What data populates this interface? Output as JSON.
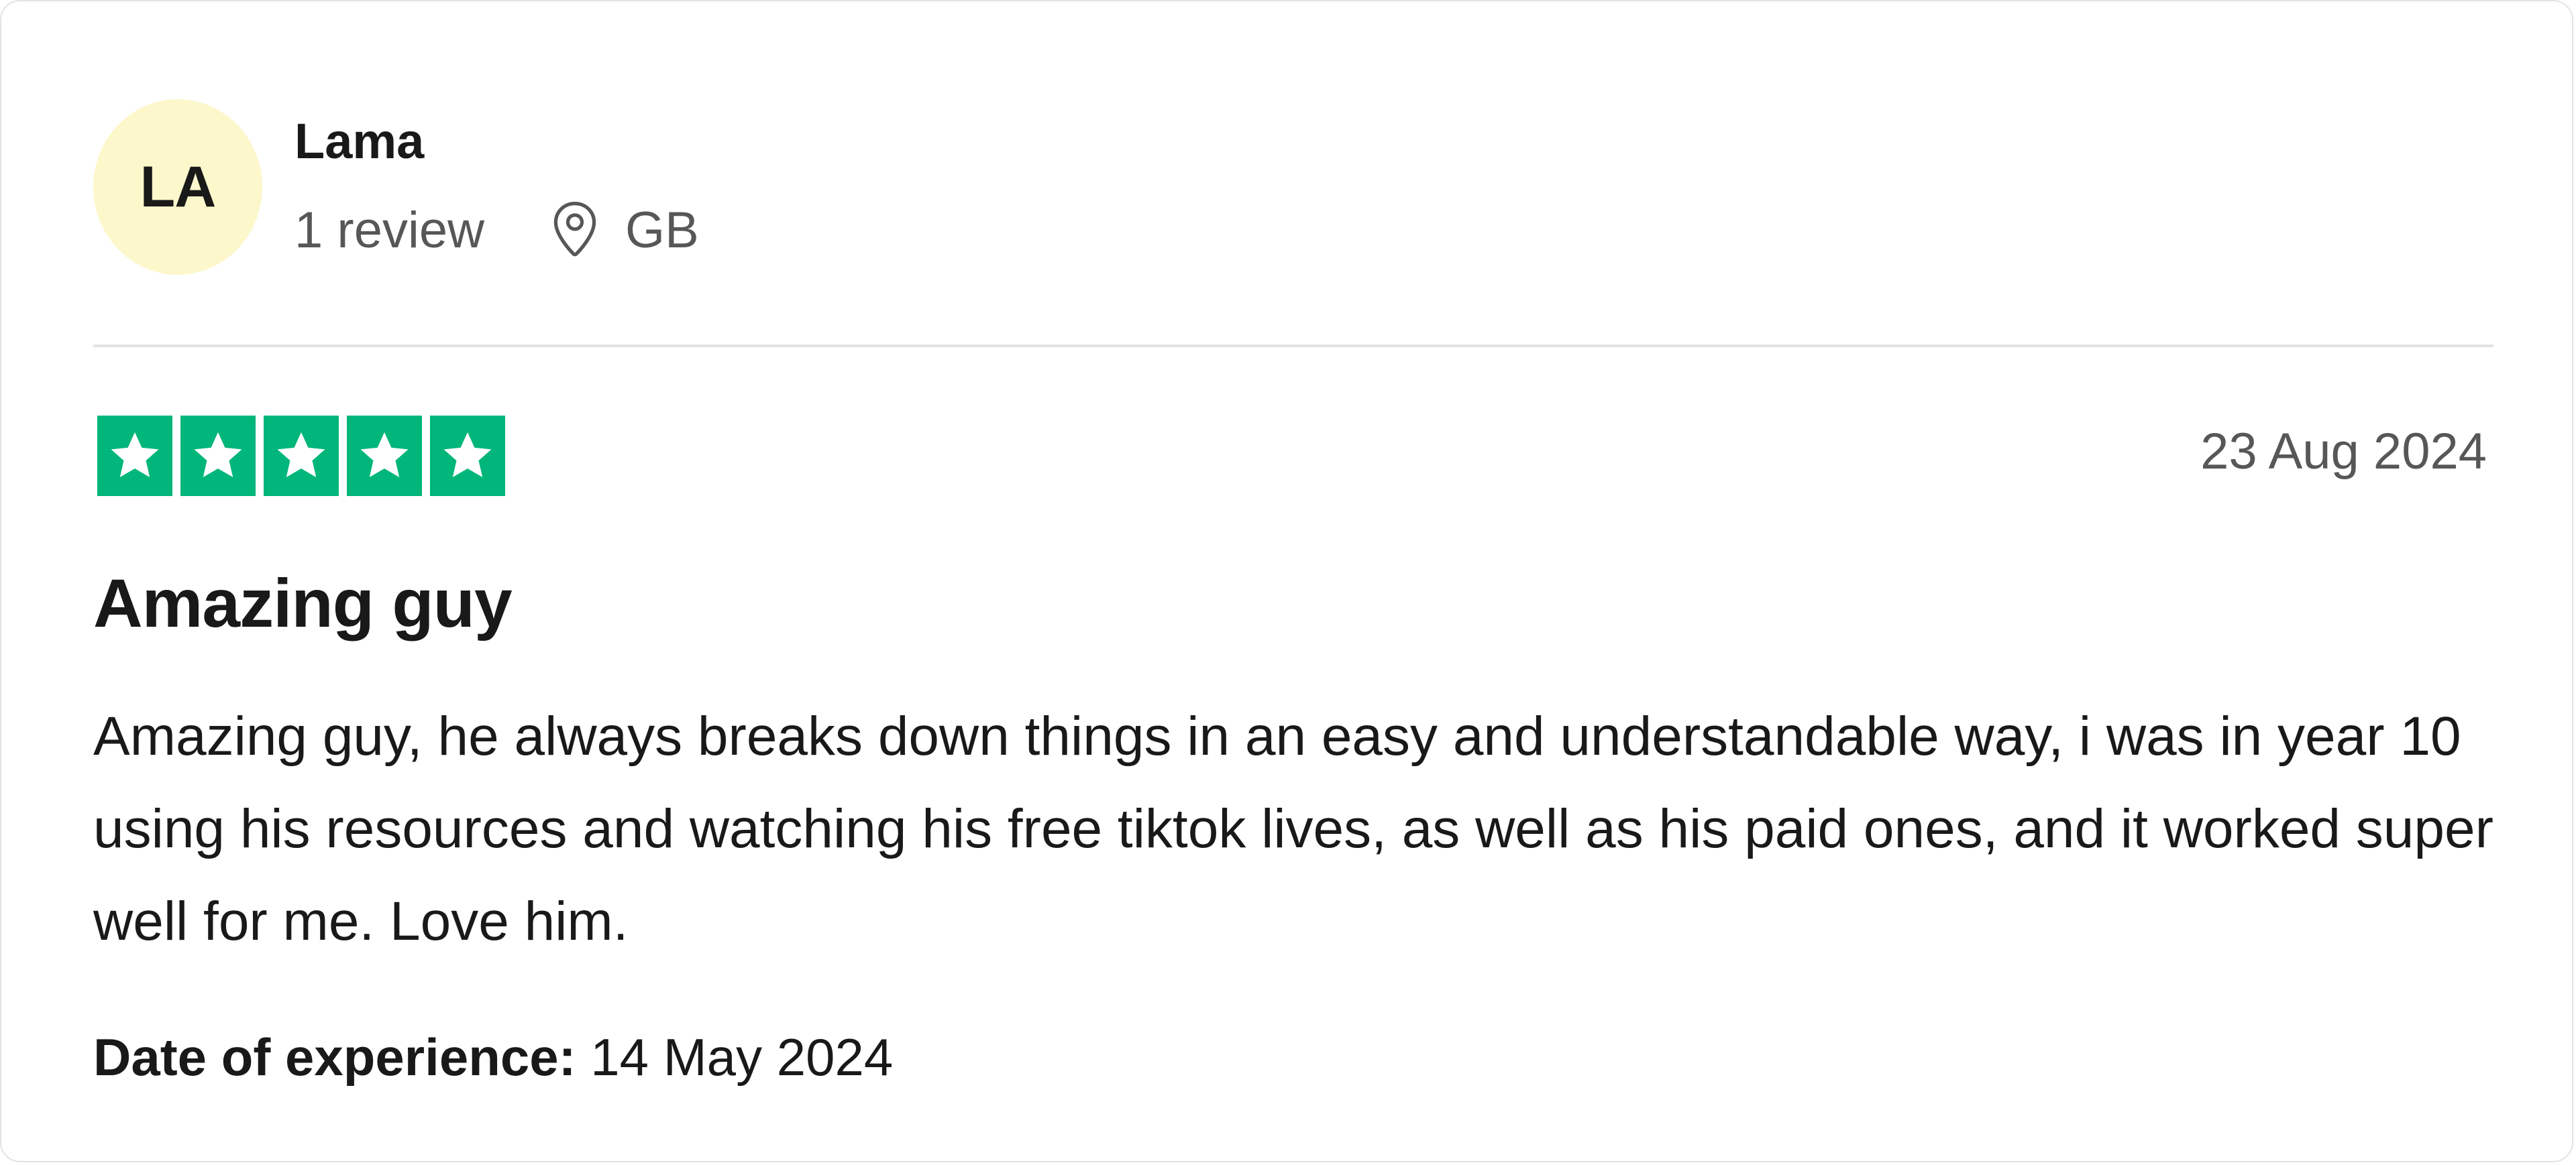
{
  "consumer": {
    "initials": "LA",
    "name": "Lama",
    "review_count": "1 review",
    "location_icon": "location-pin-icon",
    "country": "GB"
  },
  "review": {
    "rating": 5,
    "rating_max": 5,
    "star_icon": "star-icon",
    "star_color": "#00b67a",
    "date": "23 Aug 2024",
    "title": "Amazing guy",
    "text": "Amazing guy, he always breaks down things in an easy and understandable way, i was in year 10 using his resources and watching his free tiktok lives, as well as his paid ones, and it worked super well for me. Love him.",
    "experience_label": "Date of experience:",
    "experience_date": "14 May 2024"
  },
  "colors": {
    "avatar_bg": "#fdf7cc",
    "text": "#191919",
    "muted_text": "#575757",
    "divider": "#e3e3e3"
  }
}
